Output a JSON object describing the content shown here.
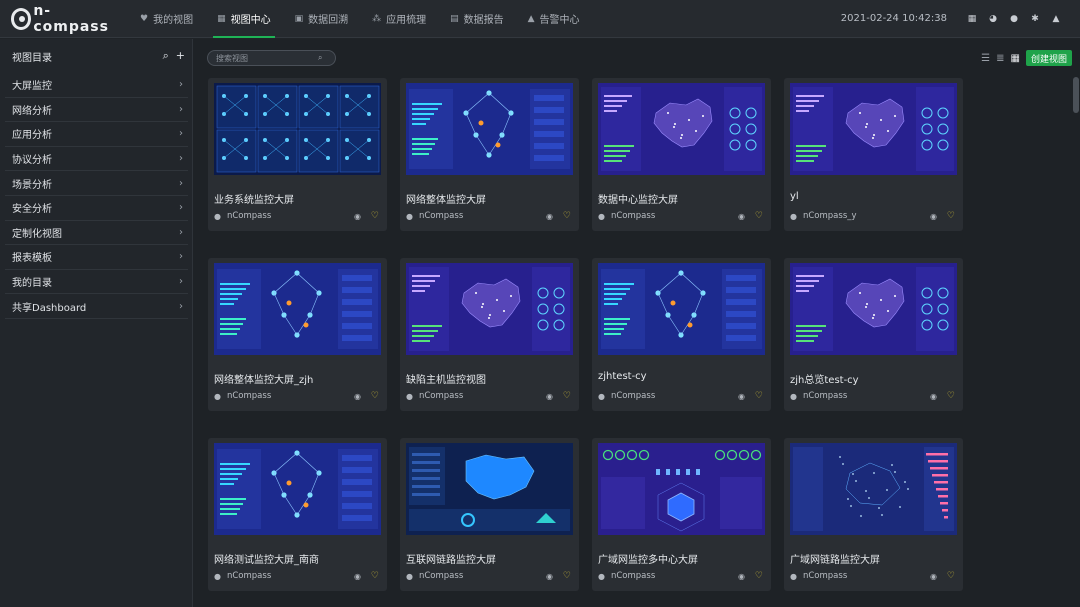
{
  "app": {
    "logo_text": "n-compass"
  },
  "nav": {
    "items": [
      {
        "label": "我的视图",
        "icon": "heart-icon"
      },
      {
        "label": "视图中心",
        "icon": "grid-icon"
      },
      {
        "label": "数据回溯",
        "icon": "replay-icon"
      },
      {
        "label": "应用梳理",
        "icon": "tree-icon"
      },
      {
        "label": "数据报告",
        "icon": "report-icon"
      },
      {
        "label": "告警中心",
        "icon": "bell-icon"
      }
    ],
    "active_index": 1
  },
  "topright": {
    "datetime": "2021-02-24 10:42:38",
    "icons": [
      "apps-icon",
      "dashboard-icon",
      "notification-icon",
      "settings-icon",
      "user-icon"
    ]
  },
  "sidebar": {
    "title": "视图目录",
    "items": [
      {
        "label": "大屏监控"
      },
      {
        "label": "网络分析"
      },
      {
        "label": "应用分析"
      },
      {
        "label": "协议分析"
      },
      {
        "label": "场景分析"
      },
      {
        "label": "安全分析"
      },
      {
        "label": "定制化视图"
      },
      {
        "label": "报表模板"
      },
      {
        "label": "我的目录"
      },
      {
        "label": "共享Dashboard"
      }
    ]
  },
  "toolbar": {
    "search_placeholder": "搜索视图",
    "create_label": "创建视图",
    "view_modes": [
      "list-view-icon",
      "detail-view-icon",
      "grid-view-icon"
    ],
    "active_view_mode": "grid-view-icon"
  },
  "colors": {
    "accent": "#1fb356",
    "button": "#1fa34a",
    "thumb_bg": "#1d2a86",
    "favorite": "#d9c437"
  },
  "cards": [
    {
      "title": "业务系统监控大屏",
      "owner": "nCompass",
      "thumb": "business"
    },
    {
      "title": "网络整体监控大屏",
      "owner": "nCompass",
      "thumb": "network"
    },
    {
      "title": "数据中心监控大屏",
      "owner": "nCompass",
      "thumb": "map"
    },
    {
      "title": "yl",
      "owner": "nCompass_y",
      "thumb": "map"
    },
    {
      "title": "网络整体监控大屏_zjh",
      "owner": "nCompass",
      "thumb": "network"
    },
    {
      "title": "缺陷主机监控视图",
      "owner": "nCompass",
      "thumb": "map"
    },
    {
      "title": "zjhtest-cy",
      "owner": "nCompass",
      "thumb": "network"
    },
    {
      "title": "zjh总览test-cy",
      "owner": "nCompass",
      "thumb": "map"
    },
    {
      "title": "网络测试监控大屏_南商",
      "owner": "nCompass",
      "thumb": "network"
    },
    {
      "title": "互联网链路监控大屏",
      "owner": "nCompass",
      "thumb": "internet"
    },
    {
      "title": "广域网监控多中心大屏",
      "owner": "nCompass",
      "thumb": "wan"
    },
    {
      "title": "广域网链路监控大屏",
      "owner": "nCompass",
      "thumb": "wanlink"
    }
  ]
}
